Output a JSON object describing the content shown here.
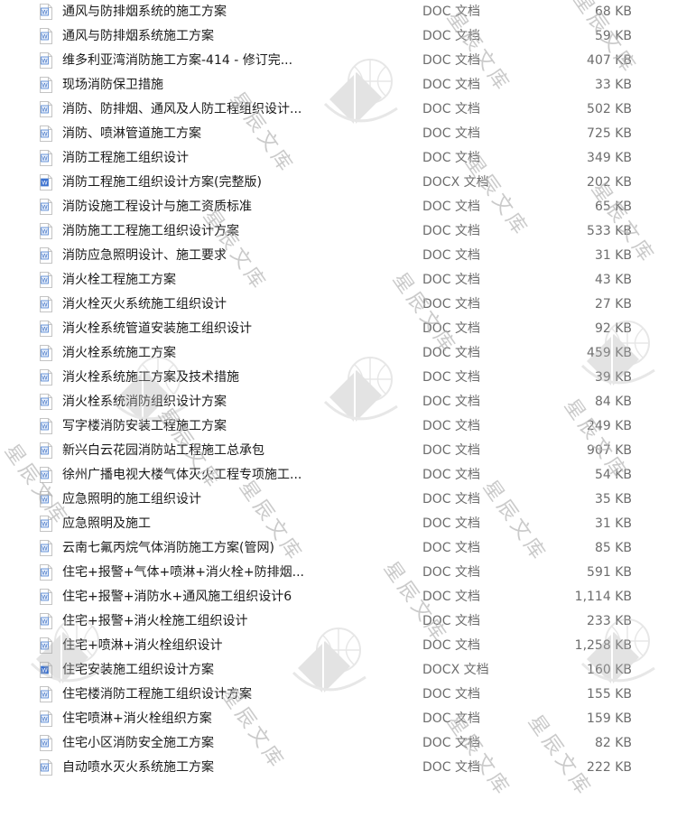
{
  "watermark": {
    "text": "星辰文库",
    "logo": "book-globe-logo"
  },
  "files": [
    {
      "name": "通风与防排烟系统的施工方案",
      "type": "DOC 文档",
      "size": "68 KB",
      "icon": "word-doc-icon"
    },
    {
      "name": "通风与防排烟系统施工方案",
      "type": "DOC 文档",
      "size": "59 KB",
      "icon": "word-doc-icon"
    },
    {
      "name": "维多利亚湾消防施工方案-414 - 修订完...",
      "type": "DOC 文档",
      "size": "407 KB",
      "icon": "word-doc-icon"
    },
    {
      "name": "现场消防保卫措施",
      "type": "DOC 文档",
      "size": "33 KB",
      "icon": "word-doc-icon"
    },
    {
      "name": "消防、防排烟、通风及人防工程组织设计...",
      "type": "DOC 文档",
      "size": "502 KB",
      "icon": "word-doc-icon"
    },
    {
      "name": "消防、喷淋管道施工方案",
      "type": "DOC 文档",
      "size": "725 KB",
      "icon": "word-doc-icon"
    },
    {
      "name": "消防工程施工组织设计",
      "type": "DOC 文档",
      "size": "349 KB",
      "icon": "word-doc-icon"
    },
    {
      "name": "消防工程施工组织设计方案(完整版)",
      "type": "DOCX 文档",
      "size": "202 KB",
      "icon": "word-docx-icon"
    },
    {
      "name": "消防设施工程设计与施工资质标准",
      "type": "DOC 文档",
      "size": "65 KB",
      "icon": "word-doc-icon"
    },
    {
      "name": "消防施工工程施工组织设计方案",
      "type": "DOC 文档",
      "size": "533 KB",
      "icon": "word-doc-icon"
    },
    {
      "name": "消防应急照明设计、施工要求",
      "type": "DOC 文档",
      "size": "31 KB",
      "icon": "word-doc-icon"
    },
    {
      "name": "消火栓工程施工方案",
      "type": "DOC 文档",
      "size": "43 KB",
      "icon": "word-doc-icon"
    },
    {
      "name": "消火栓灭火系统施工组织设计",
      "type": "DOC 文档",
      "size": "27 KB",
      "icon": "word-doc-icon"
    },
    {
      "name": "消火栓系统管道安装施工组织设计",
      "type": "DOC 文档",
      "size": "92 KB",
      "icon": "word-doc-icon"
    },
    {
      "name": "消火栓系统施工方案",
      "type": "DOC 文档",
      "size": "459 KB",
      "icon": "word-doc-icon"
    },
    {
      "name": "消火栓系统施工方案及技术措施",
      "type": "DOC 文档",
      "size": "39 KB",
      "icon": "word-doc-icon"
    },
    {
      "name": "消火栓系统消防组织设计方案",
      "type": "DOC 文档",
      "size": "84 KB",
      "icon": "word-doc-icon"
    },
    {
      "name": "写字楼消防安装工程施工方案",
      "type": "DOC 文档",
      "size": "249 KB",
      "icon": "word-doc-icon"
    },
    {
      "name": "新兴白云花园消防站工程施工总承包",
      "type": "DOC 文档",
      "size": "907 KB",
      "icon": "word-doc-icon"
    },
    {
      "name": "徐州广播电视大楼气体灭火工程专项施工...",
      "type": "DOC 文档",
      "size": "54 KB",
      "icon": "word-doc-icon"
    },
    {
      "name": "应急照明的施工组织设计",
      "type": "DOC 文档",
      "size": "35 KB",
      "icon": "word-doc-icon"
    },
    {
      "name": "应急照明及施工",
      "type": "DOC 文档",
      "size": "31 KB",
      "icon": "word-doc-icon"
    },
    {
      "name": "云南七氟丙烷气体消防施工方案(管网)",
      "type": "DOC 文档",
      "size": "85 KB",
      "icon": "word-doc-icon"
    },
    {
      "name": "住宅+报警+气体+喷淋+消火栓+防排烟...",
      "type": "DOC 文档",
      "size": "591 KB",
      "icon": "word-doc-icon"
    },
    {
      "name": "住宅+报警+消防水+通风施工组织设计6",
      "type": "DOC 文档",
      "size": "1,114 KB",
      "icon": "word-doc-icon"
    },
    {
      "name": "住宅+报警+消火栓施工组织设计",
      "type": "DOC 文档",
      "size": "233 KB",
      "icon": "word-doc-icon"
    },
    {
      "name": "住宅+喷淋+消火栓组织设计",
      "type": "DOC 文档",
      "size": "1,258 KB",
      "icon": "word-doc-icon"
    },
    {
      "name": "住宅安装施工组织设计方案",
      "type": "DOCX 文档",
      "size": "160 KB",
      "icon": "word-docx-icon"
    },
    {
      "name": "住宅楼消防工程施工组织设计方案",
      "type": "DOC 文档",
      "size": "155 KB",
      "icon": "word-doc-icon"
    },
    {
      "name": "住宅喷淋+消火栓组织方案",
      "type": "DOC 文档",
      "size": "159 KB",
      "icon": "word-doc-icon"
    },
    {
      "name": "住宅小区消防安全施工方案",
      "type": "DOC 文档",
      "size": "82 KB",
      "icon": "word-doc-icon"
    },
    {
      "name": "自动喷水灭火系统施工方案",
      "type": "DOC 文档",
      "size": "222 KB",
      "icon": "word-doc-icon"
    }
  ]
}
